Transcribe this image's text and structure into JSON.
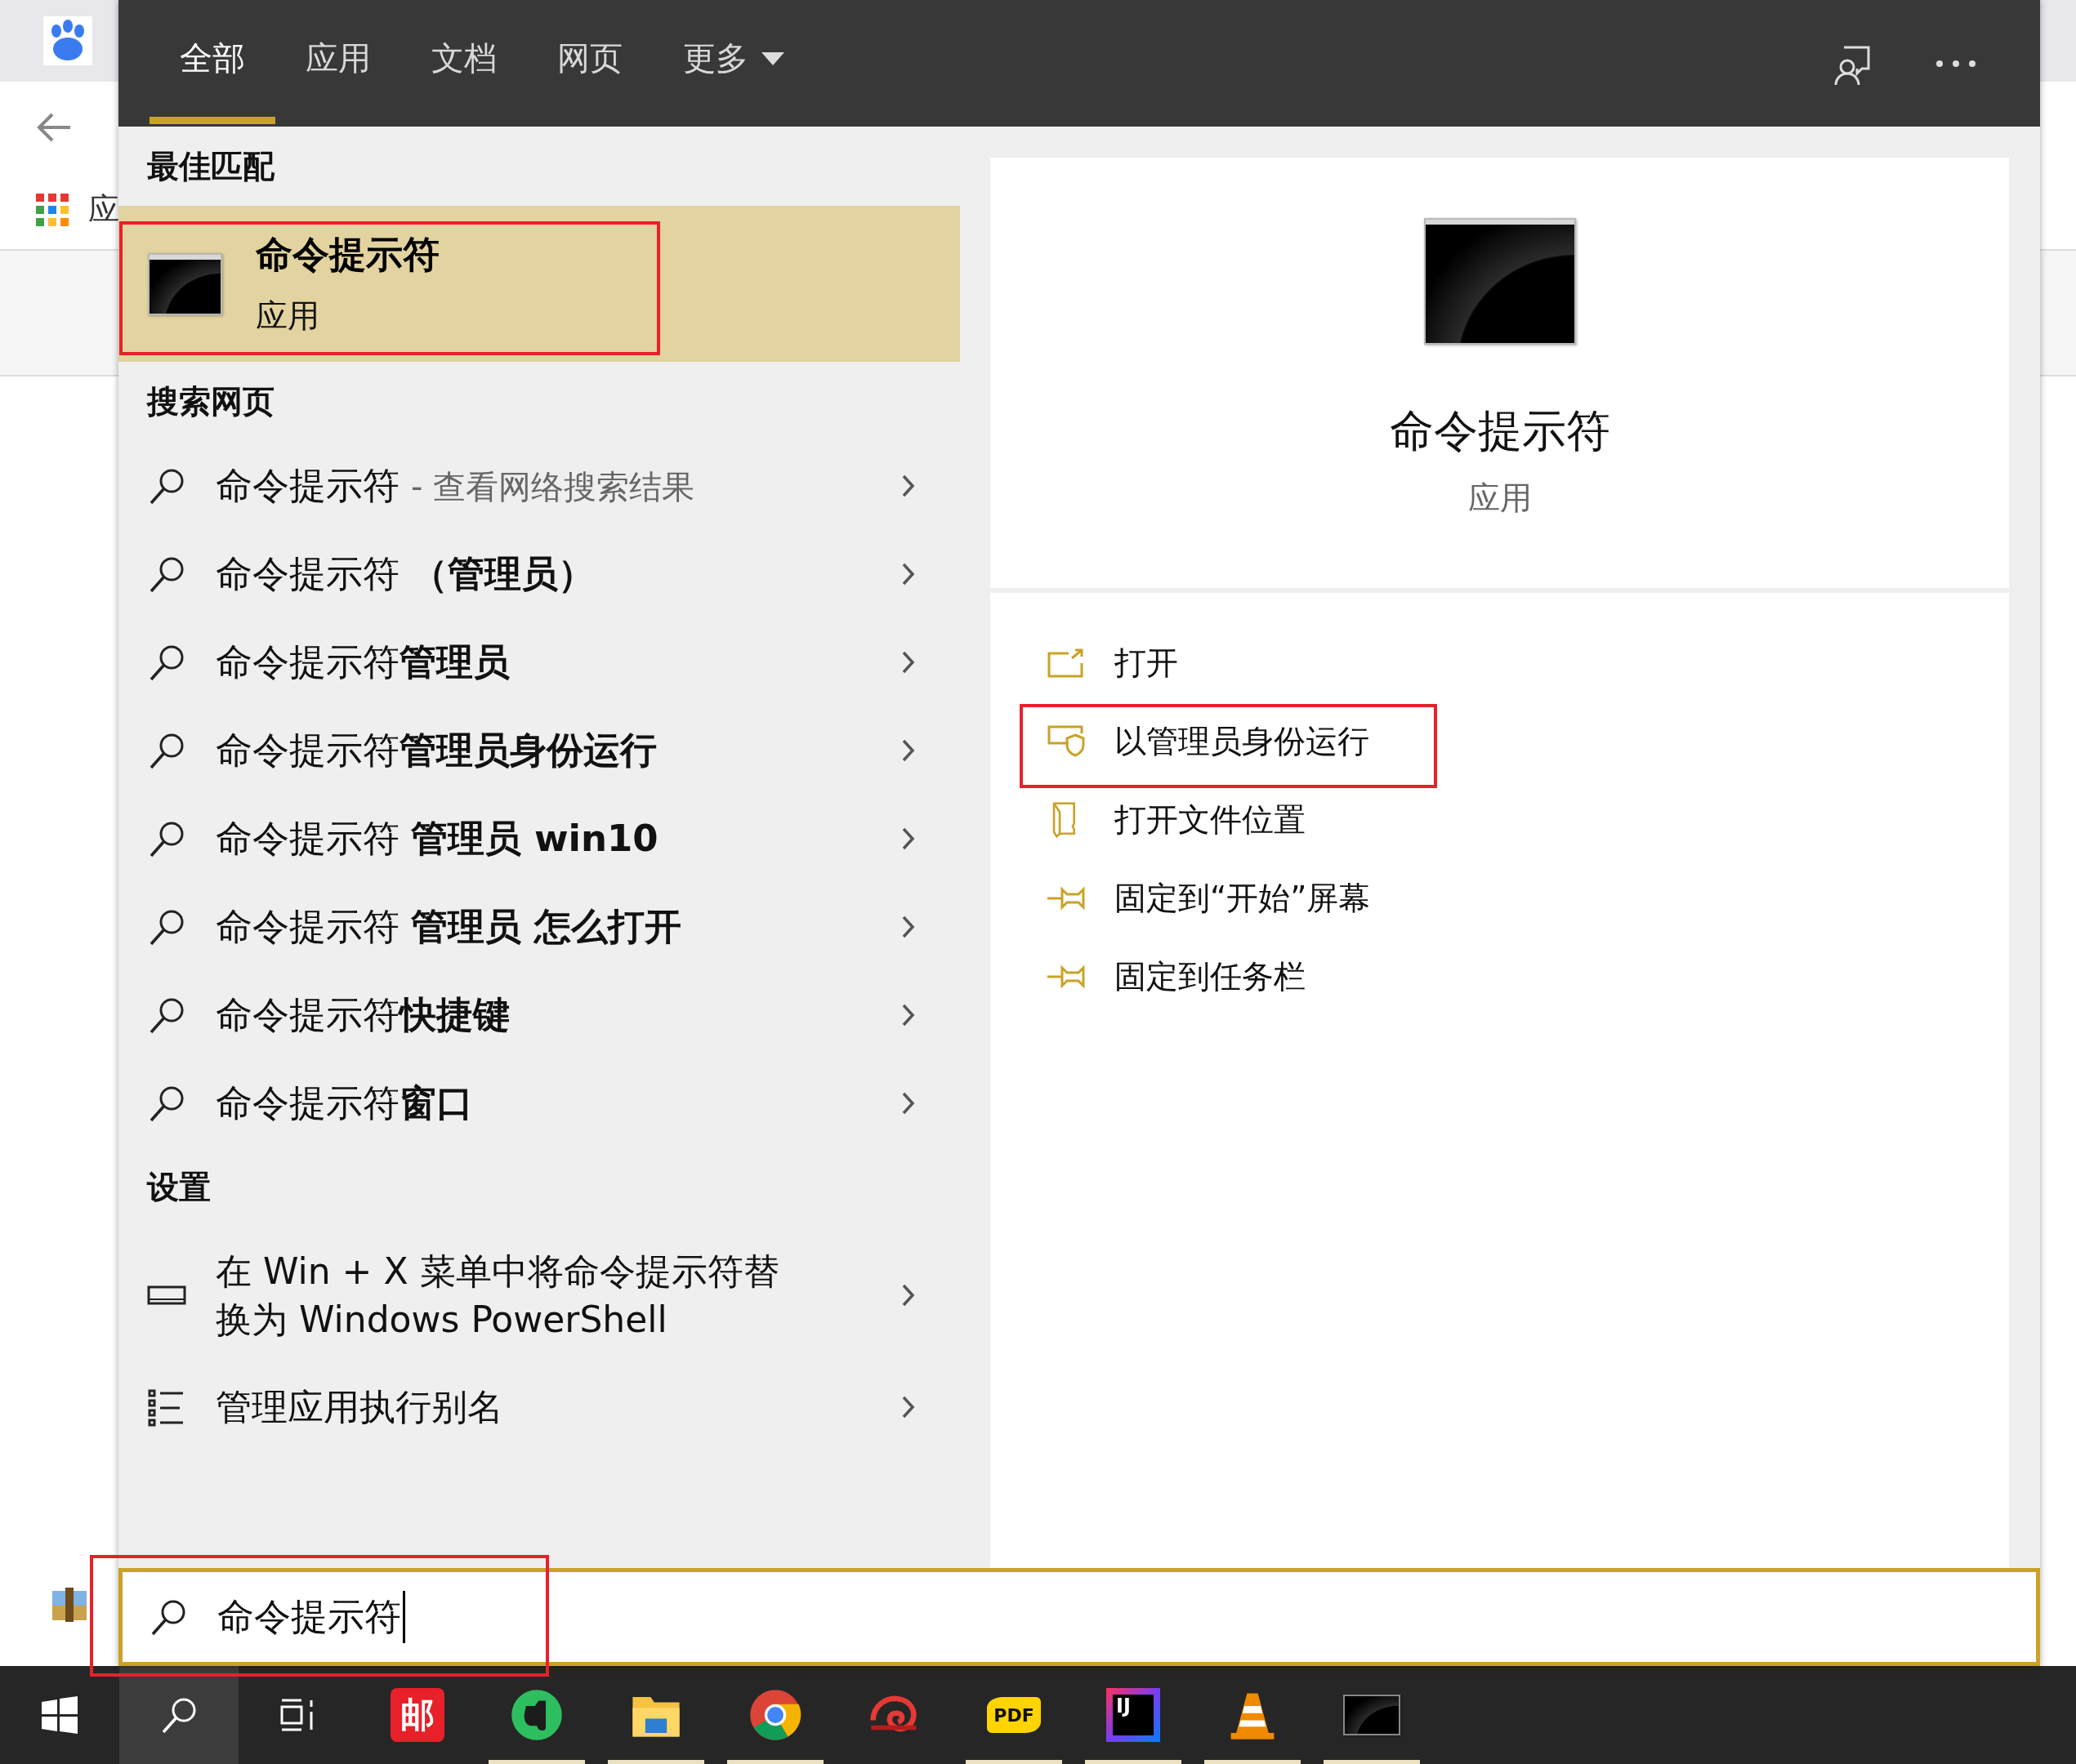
{
  "browser": {
    "apps_label": "应"
  },
  "search_panel": {
    "tabs": [
      {
        "label": "全部",
        "selected": true,
        "has_menu": false
      },
      {
        "label": "应用",
        "selected": false,
        "has_menu": false
      },
      {
        "label": "文档",
        "selected": false,
        "has_menu": false
      },
      {
        "label": "网页",
        "selected": false,
        "has_menu": false
      },
      {
        "label": "更多",
        "selected": false,
        "has_menu": true
      }
    ],
    "best_match": {
      "heading": "最佳匹配",
      "title": "命令提示符",
      "subtitle": "应用",
      "selected": true
    },
    "web_search": {
      "heading": "搜索网页",
      "results": [
        {
          "text": "命令提示符",
          "suffix": "- 查看网络搜索结果"
        },
        {
          "text": "命令提示符 **（管理员）**"
        },
        {
          "text": "命令提示符**管理员**"
        },
        {
          "text": "命令提示符**管理员身份运行**"
        },
        {
          "text": "命令提示符 **管理员 win10**"
        },
        {
          "text": "命令提示符 **管理员 怎么打开**"
        },
        {
          "text": "命令提示符**快捷键**"
        },
        {
          "text": "命令提示符**窗口**"
        }
      ]
    },
    "settings": {
      "heading": "设置",
      "items": [
        {
          "kind": "display",
          "text": "在 Win + X 菜单中将命令提示符替换为 Windows PowerShell"
        },
        {
          "kind": "list",
          "text": "管理应用执行别名"
        }
      ]
    },
    "preview": {
      "title": "命令提示符",
      "subtitle": "应用",
      "actions": [
        {
          "kind": "open",
          "label": "打开"
        },
        {
          "kind": "admin",
          "label": "以管理员身份运行"
        },
        {
          "kind": "folder",
          "label": "打开文件位置"
        },
        {
          "kind": "pin",
          "label": "固定到“开始”屏幕"
        },
        {
          "kind": "pin",
          "label": "固定到任务栏"
        }
      ]
    },
    "search_box": {
      "value": "命令提示符"
    }
  },
  "taskbar": {
    "apps": [
      {
        "kind": "mail",
        "label": "邮",
        "running": false
      },
      {
        "kind": "evernote",
        "running": true
      },
      {
        "kind": "explorer",
        "running": true
      },
      {
        "kind": "chrome",
        "running": true
      },
      {
        "kind": "snail",
        "running": false
      },
      {
        "kind": "pdf",
        "label": "PDF",
        "running": true
      },
      {
        "kind": "intellij",
        "label": "IJ",
        "running": true
      },
      {
        "kind": "vlc",
        "running": true
      },
      {
        "kind": "cmd",
        "running": true
      }
    ]
  }
}
